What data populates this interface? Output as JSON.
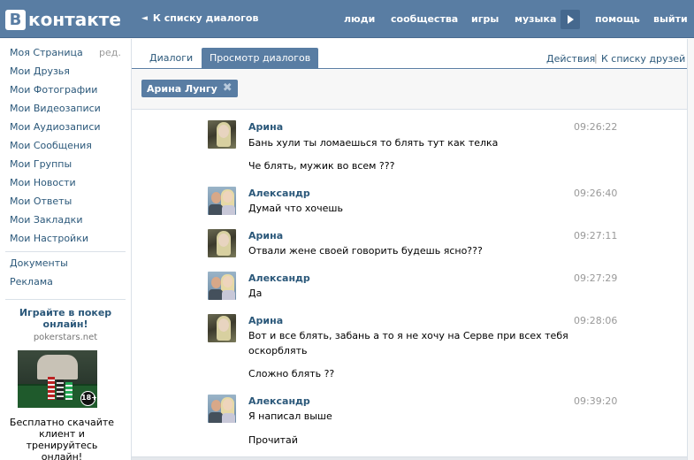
{
  "header": {
    "logo_letter": "B",
    "logo_text": "контакте",
    "back_label": "К списку диалогов",
    "nav": [
      "люди",
      "сообщества",
      "игры",
      "музыка",
      "помощь",
      "выйти"
    ]
  },
  "sidebar": {
    "items": [
      "Моя Страница",
      "Мои Друзья",
      "Мои Фотографии",
      "Мои Видеозаписи",
      "Мои Аудиозаписи",
      "Мои Сообщения",
      "Мои Группы",
      "Мои Новости",
      "Мои Ответы",
      "Мои Закладки",
      "Мои Настройки"
    ],
    "edit_label": "ред.",
    "extra_items": [
      "Документы",
      "Реклама"
    ],
    "ad": {
      "title": "Играйте в покер онлайн!",
      "domain": "pokerstars.net",
      "badge": "18+",
      "text": "Бесплатно скачайте клиент и тренируйтесь онлайн!"
    }
  },
  "tabs": {
    "dialogs": "Диалоги",
    "view": "Просмотр диалогов",
    "actions": "Действия",
    "separator": "|",
    "friends": "К списку друзей"
  },
  "filter": {
    "chip_label": "Арина Лунгу",
    "close_glyph": "✖"
  },
  "messages": [
    {
      "author": "Арина",
      "time": "09:26:22",
      "lines": [
        "Бань хули ты ломаешься то блять тут как телка",
        "",
        "Че блять, мужик во всем ???"
      ]
    },
    {
      "author": "Александр",
      "time": "09:26:40",
      "lines": [
        "Думай что хочешь"
      ]
    },
    {
      "author": "Арина",
      "time": "09:27:11",
      "lines": [
        "Отвали жене своей говорить будешь ясно???"
      ]
    },
    {
      "author": "Александр",
      "time": "09:27:29",
      "lines": [
        "Да"
      ]
    },
    {
      "author": "Арина",
      "time": "09:28:06",
      "lines": [
        "Вот и все блять, забань а то я не хочу на Серве при всех тебя",
        "оскорблять",
        "",
        "Сложно блять ??"
      ]
    },
    {
      "author": "Александр",
      "time": "09:39:20",
      "lines": [
        "Я написал выше",
        "",
        "Прочитай"
      ]
    }
  ]
}
